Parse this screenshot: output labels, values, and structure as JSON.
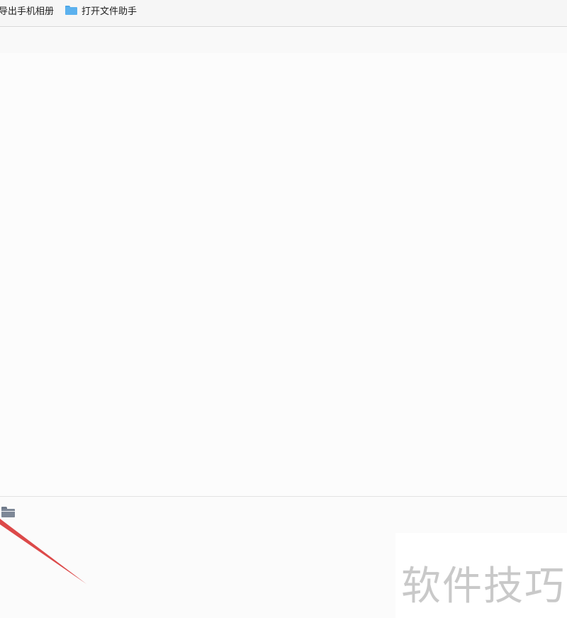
{
  "toolbar": {
    "export_label": "导出手机相册",
    "open_label": "打开文件助手"
  },
  "icons": {
    "open_icon": "folder-icon",
    "file_icon": "folder-icon"
  },
  "colors": {
    "folder_blue": "#5bb1ee",
    "arrow_red": "#d93a3a"
  },
  "watermark": {
    "text": "软件技巧"
  }
}
